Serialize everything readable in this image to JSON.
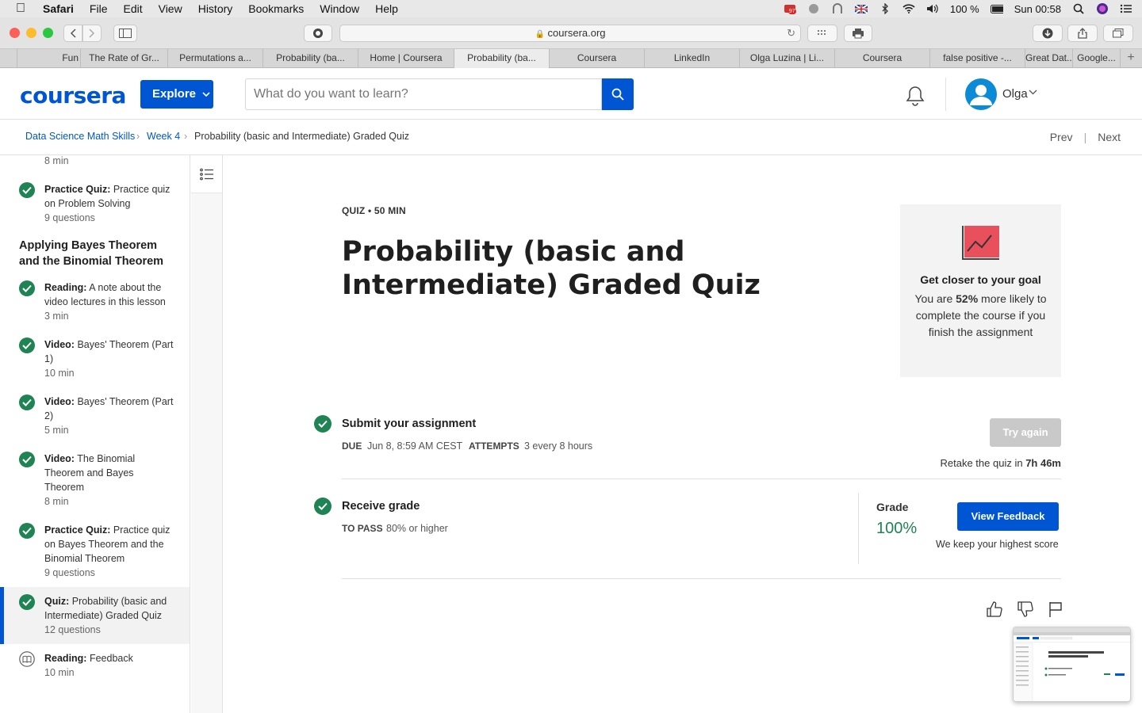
{
  "menubar": {
    "app": "Safari",
    "items": [
      "File",
      "Edit",
      "View",
      "History",
      "Bookmarks",
      "Window",
      "Help"
    ],
    "battery": "100 %",
    "clock": "Sun 00:58",
    "badge": "97"
  },
  "browser": {
    "url": "coursera.org",
    "tabs": [
      "Fun",
      "The Rate of Gr...",
      "Permutations a...",
      "Probability (ba...",
      "Home | Coursera",
      "Probability (ba...",
      "Coursera",
      "LinkedIn",
      "Olga Luzina | Li...",
      "Coursera",
      "false positive -...",
      "Great Dat...",
      "Google..."
    ],
    "active_tab_index": 5
  },
  "header": {
    "logo": "coursera",
    "explore": "Explore",
    "search_placeholder": "What do you want to learn?",
    "user": "Olga"
  },
  "breadcrumb": {
    "items": [
      "Data Science Math Skills",
      "Week 4",
      "Probability (basic and Intermediate) Graded Quiz"
    ],
    "prev": "Prev",
    "next": "Next"
  },
  "sidebar": {
    "top_meta": "8 min",
    "section_title": "Applying Bayes Theorem and the Binomial Theorem",
    "items": [
      {
        "type": "Practice Quiz:",
        "title": "Practice quiz on Problem Solving",
        "meta": "9 questions"
      },
      {
        "type": "Reading:",
        "title": "A note about the video lectures in this lesson",
        "meta": "3 min"
      },
      {
        "type": "Video:",
        "title": "Bayes' Theorem (Part 1)",
        "meta": "10 min"
      },
      {
        "type": "Video:",
        "title": "Bayes' Theorem (Part 2)",
        "meta": "5 min"
      },
      {
        "type": "Video:",
        "title": "The Binomial Theorem and Bayes Theorem",
        "meta": "8 min"
      },
      {
        "type": "Practice Quiz:",
        "title": "Practice quiz on Bayes Theorem and the Binomial Theorem",
        "meta": "9 questions"
      },
      {
        "type": "Quiz:",
        "title": "Probability (basic and Intermediate) Graded Quiz",
        "meta": "12 questions"
      },
      {
        "type": "Reading:",
        "title": "Feedback",
        "meta": "10 min"
      }
    ]
  },
  "main": {
    "kicker": "QUIZ • 50 MIN",
    "title": "Probability (basic and Intermediate) Graded Quiz",
    "goal": {
      "title": "Get closer to your goal",
      "text_pre": "You are ",
      "percent": "52%",
      "text_post": " more likely to complete the course if you finish the assignment"
    },
    "submit": {
      "title": "Submit your assignment",
      "due_label": "DUE",
      "due_value": "Jun 8, 8:59 AM CEST",
      "attempts_label": "ATTEMPTS",
      "attempts_value": "3 every 8 hours",
      "button": "Try again",
      "retake_pre": "Retake the quiz in ",
      "retake_time": "7h 46m"
    },
    "grade": {
      "title": "Receive grade",
      "pass_label": "TO PASS",
      "pass_value": "80% or higher",
      "grade_label": "Grade",
      "grade_value": "100%",
      "button": "View Feedback",
      "note": "We keep your highest score"
    }
  },
  "colors": {
    "brand": "#0056d2",
    "success": "#1f8354",
    "goal_icon": "#e8505b"
  }
}
